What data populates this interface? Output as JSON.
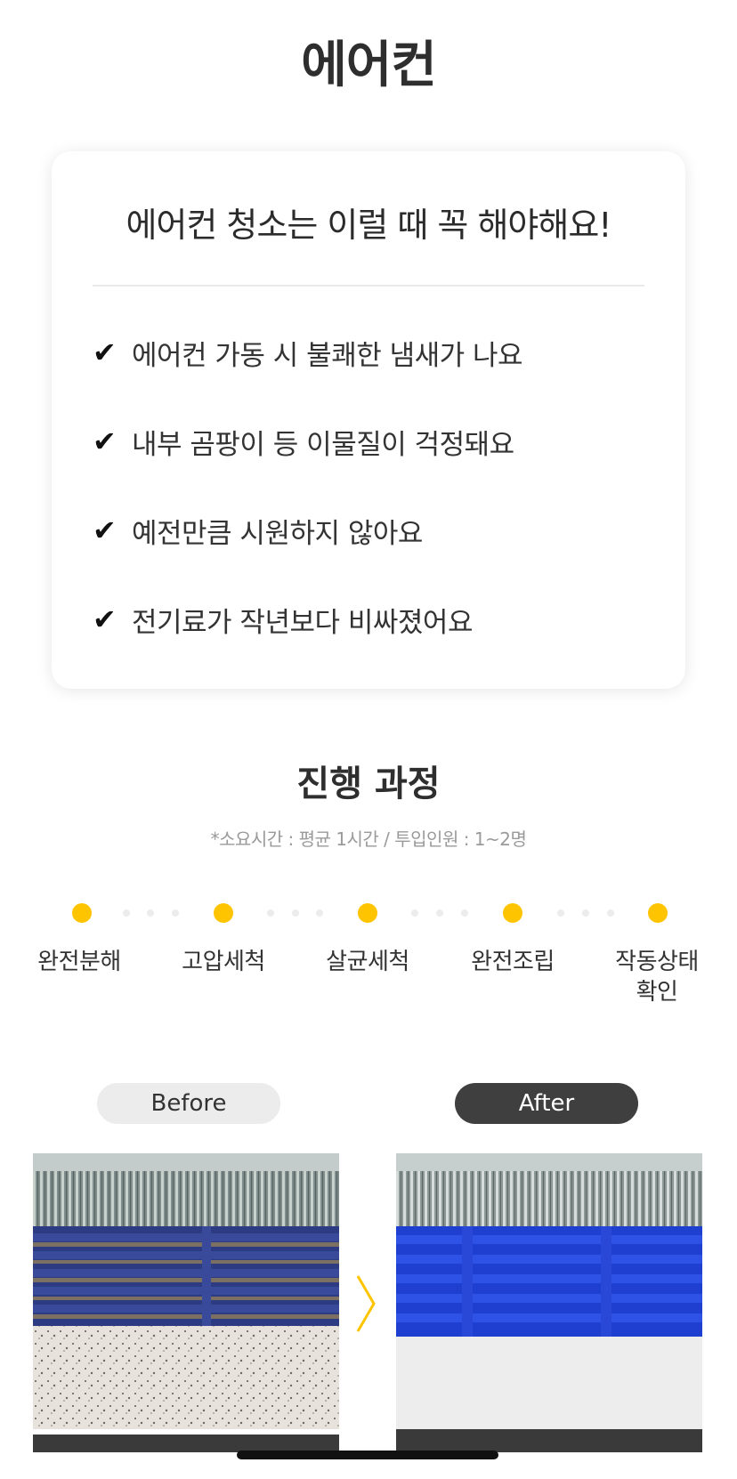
{
  "header": {
    "title": "에어컨"
  },
  "checklist": {
    "title": "에어컨 청소는 이럴 때 꼭 해야해요!",
    "check_glyph": "✔",
    "items": [
      {
        "text": "에어컨 가동 시 불쾌한 냄새가 나요"
      },
      {
        "text": "내부 곰팡이 등 이물질이 걱정돼요"
      },
      {
        "text": "예전만큼 시원하지 않아요"
      },
      {
        "text": "전기료가 작년보다 비싸졌어요"
      }
    ]
  },
  "process": {
    "title": "진행 과정",
    "subtitle": "*소요시간 : 평균 1시간 / 투입인원 : 1~2명",
    "accent_color": "#ffc400",
    "steps": [
      {
        "label": "완전분해"
      },
      {
        "label": "고압세척"
      },
      {
        "label": "살균세척"
      },
      {
        "label": "완전조립"
      },
      {
        "label": "작동상태\n확인"
      }
    ]
  },
  "comparison": {
    "before_label": "Before",
    "after_label": "After",
    "arrow_icon": "chevron-right-icon"
  }
}
